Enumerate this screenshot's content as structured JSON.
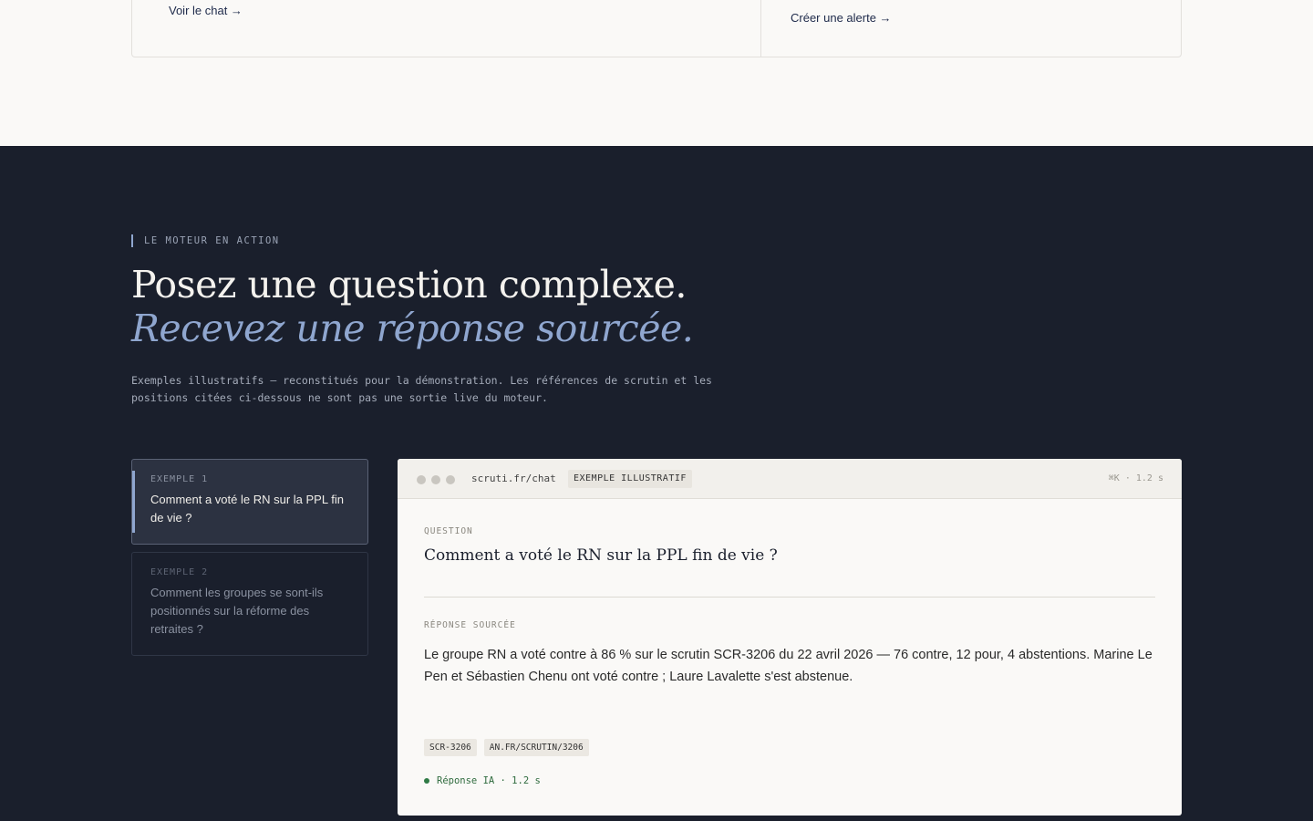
{
  "top": {
    "left_link": "Voir le chat →",
    "right_link": "Créer une alerte →"
  },
  "section": {
    "eyebrow": "LE MOTEUR EN ACTION",
    "headline": "Posez une question complexe.",
    "headline_italic": "Recevez une réponse sourcée.",
    "disclaimer": "Exemples illustratifs — reconstitués pour la démonstration. Les références de scrutin et les positions citées ci-dessous ne sont pas une sortie live du moteur."
  },
  "examples": [
    {
      "label": "EXEMPLE 1",
      "text": "Comment a voté le RN sur la PPL fin de vie ?"
    },
    {
      "label": "EXEMPLE 2",
      "text": "Comment les groupes se sont-ils positionnés sur la réforme des retraites ?"
    }
  ],
  "chat": {
    "url": "scruti.fr/chat",
    "badge": "EXEMPLE ILLUSTRATIF",
    "meta": "⌘K · 1.2 s",
    "question_label": "QUESTION",
    "question": "Comment a voté le RN sur la PPL fin de vie ?",
    "answer_label": "RÉPONSE SOURCÉE",
    "answer": "Le groupe RN a voté contre à 86 % sur le scrutin SCR-3206 du 22 avril 2026 — 76 contre, 12 pour, 4 abstentions. Marine Le Pen et Sébastien Chenu ont voté contre ; Laure Lavalette s'est abstenue.",
    "tags": [
      "SCR-3206",
      "AN.FR/SCRUTIN/3206"
    ],
    "status": "Réponse IA · 1.2 s"
  },
  "colors": {
    "dark_bg": "#1a1f2c",
    "accent": "#8fa6cf",
    "status_green": "#2f7a45"
  }
}
